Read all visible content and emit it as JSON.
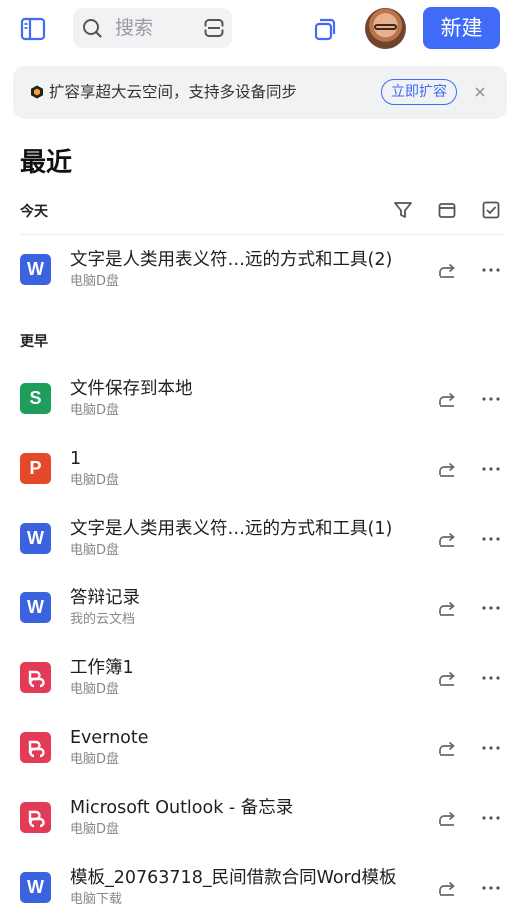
{
  "topbar": {
    "search_placeholder": "搜索",
    "new_label": "新建",
    "icons": [
      "sidebar-icon",
      "search-icon",
      "scan-icon",
      "multi-window-icon",
      "avatar"
    ]
  },
  "banner": {
    "text": "扩容享超大云空间，支持多设备同步",
    "action_label": "立即扩容",
    "icons": [
      "storage-badge-icon",
      "close-icon"
    ]
  },
  "recent": {
    "title": "最近",
    "today_label": "今天",
    "earlier_label": "更早",
    "tool_icons": [
      "filter-icon",
      "view-toggle-icon",
      "select-icon"
    ]
  },
  "files_today": [
    {
      "type": "W",
      "kind": "word",
      "title": "文字是人类用表义符…远的方式和工具(2)",
      "location": "电脑D盘"
    }
  ],
  "files_earlier": [
    {
      "type": "S",
      "kind": "sheet",
      "title": "文件保存到本地",
      "location": "电脑D盘"
    },
    {
      "type": "P",
      "kind": "ppt",
      "title": "1",
      "location": "电脑D盘"
    },
    {
      "type": "W",
      "kind": "word",
      "title": "文字是人类用表义符…远的方式和工具(1)",
      "location": "电脑D盘"
    },
    {
      "type": "W",
      "kind": "word",
      "title": "答辩记录",
      "location": "我的云文档"
    },
    {
      "type": "",
      "kind": "pdf",
      "title": "工作簿1",
      "location": "电脑D盘"
    },
    {
      "type": "",
      "kind": "pdf",
      "title": "Evernote",
      "location": "电脑D盘"
    },
    {
      "type": "",
      "kind": "pdf",
      "title": "Microsoft Outlook - 备忘录",
      "location": "电脑D盘"
    },
    {
      "type": "W",
      "kind": "word",
      "title": "模板_20763718_民间借款合同Word模板",
      "location": "电脑下载"
    }
  ],
  "colors": {
    "accent": "#3f6bf6",
    "word": "#3b63e0",
    "sheet": "#1f9d5a",
    "ppt": "#e5492c",
    "pdf": "#e23a57"
  }
}
